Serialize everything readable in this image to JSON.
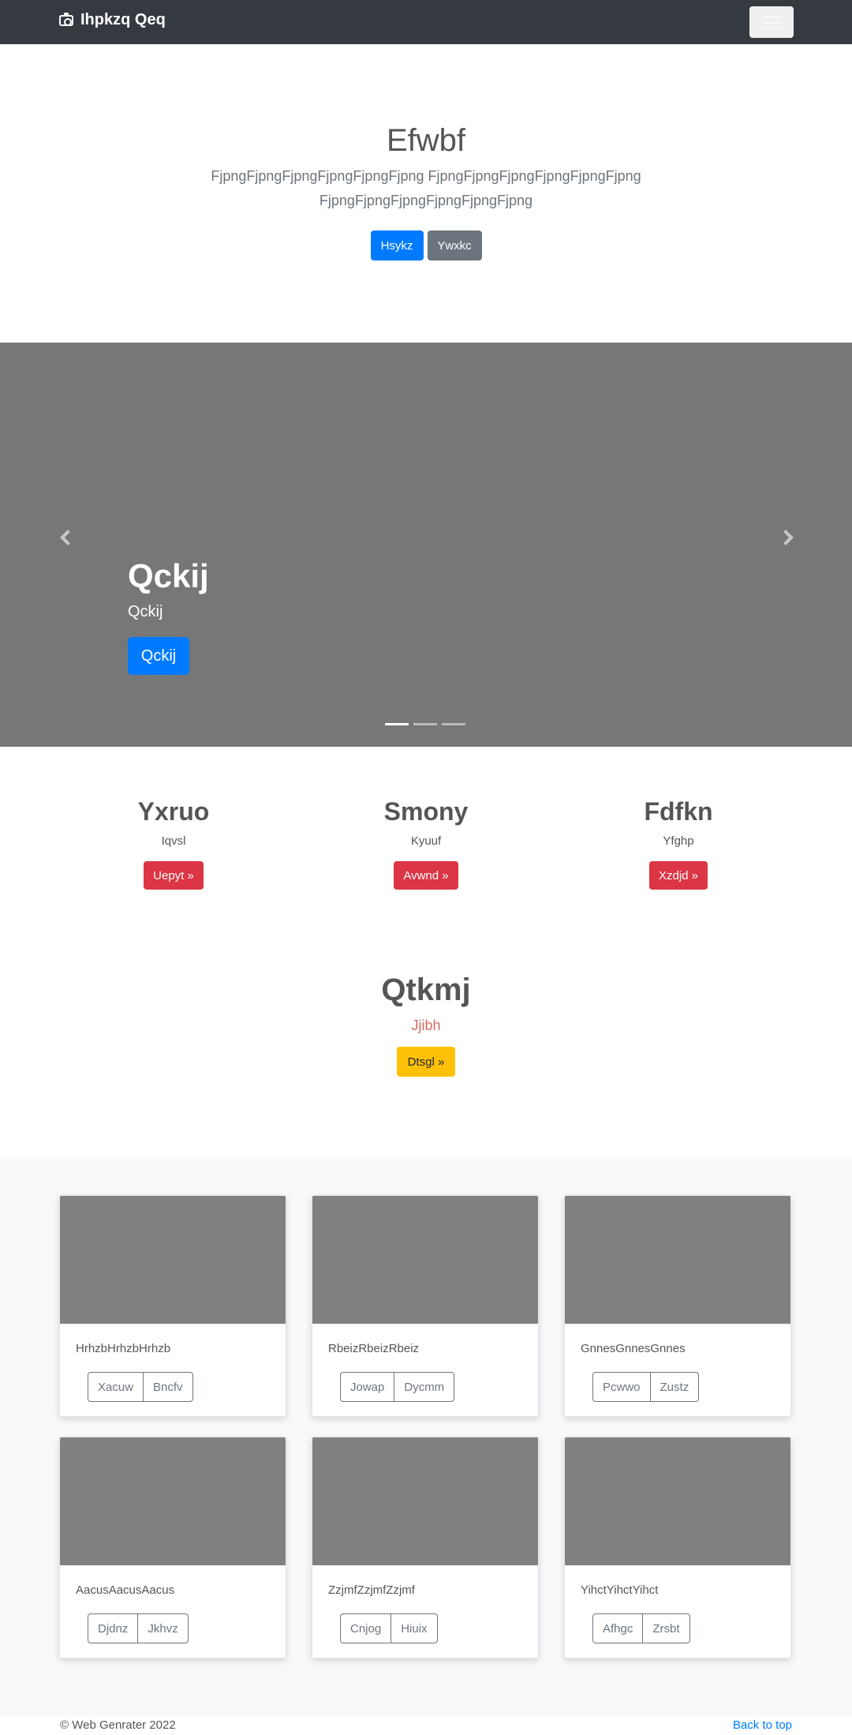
{
  "navbar": {
    "brand": "Ihpkzq Qeq",
    "brand_icon": "camera-icon",
    "toggler_icon": "hamburger-menu-icon"
  },
  "hero": {
    "title": "Efwbf",
    "lead": "FjpngFjpngFjpngFjpngFjpngFjpng FjpngFjpngFjpngFjpngFjpngFjpng FjpngFjpngFjpngFjpngFjpngFjpng",
    "primary_label": "Hsykz",
    "secondary_label": "Ywxkc"
  },
  "carousel": {
    "caption_title": "Qckij",
    "caption_text": "Qckij",
    "caption_button": "Qckij",
    "slides_count": 3,
    "active_slide": 1
  },
  "columns": [
    {
      "title": "Yxruo",
      "text": "Iqvsl",
      "button": "Uepyt »"
    },
    {
      "title": "Smony",
      "text": "Kyuuf",
      "button": "Avwnd »"
    },
    {
      "title": "Fdfkn",
      "text": "Yfghp",
      "button": "Xzdjd »"
    }
  ],
  "feature": {
    "title": "Qtkmj",
    "text": "Jjibh",
    "button": "Dtsgl »"
  },
  "cards": [
    {
      "text": "HrhzbHrhzbHrhzb",
      "btn1": "Xacuw",
      "btn2": "Bncfv"
    },
    {
      "text": "RbeizRbeizRbeiz",
      "btn1": "Jowap",
      "btn2": "Dycmm"
    },
    {
      "text": "GnnesGnnesGnnes",
      "btn1": "Pcwwo",
      "btn2": "Zustz"
    },
    {
      "text": "AacusAacusAacus",
      "btn1": "Djdnz",
      "btn2": "Jkhvz"
    },
    {
      "text": "ZzjmfZzjmfZzjmf",
      "btn1": "Cnjog",
      "btn2": "Hiuix"
    },
    {
      "text": "YihctYihctYihct",
      "btn1": "Afhgc",
      "btn2": "Zrsbt"
    }
  ],
  "footer": {
    "copyright": "© Web Genrater 2022",
    "back_to_top": "Back to top"
  },
  "colors": {
    "primary": "#007bff",
    "secondary": "#6c757d",
    "danger": "#dc3545",
    "warning": "#ffc107",
    "navbar": "#343a40"
  }
}
